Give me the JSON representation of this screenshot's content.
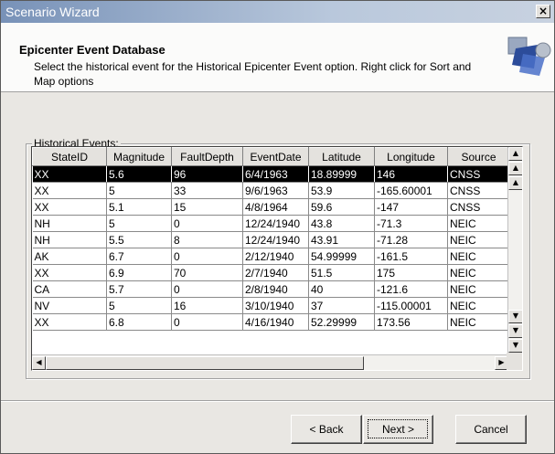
{
  "window": {
    "title": "Scenario Wizard",
    "close_label": "×"
  },
  "header": {
    "title": "Epicenter Event Database",
    "description": "Select the historical event for the Historical Epicenter Event option. Right click for Sort and Map options"
  },
  "group": {
    "label": "Historical Events:"
  },
  "table": {
    "columns": [
      "StateID",
      "Magnitude",
      "FaultDepth",
      "EventDate",
      "Latitude",
      "Longitude",
      "Source"
    ],
    "selected_row": 0,
    "rows": [
      [
        "XX",
        "5.6",
        "96",
        "6/4/1963",
        "18.89999",
        "146",
        "CNSS"
      ],
      [
        "XX",
        "5",
        "33",
        "9/6/1963",
        "53.9",
        "-165.60001",
        "CNSS"
      ],
      [
        "XX",
        "5.1",
        "15",
        "4/8/1964",
        "59.6",
        "-147",
        "CNSS"
      ],
      [
        "NH",
        "5",
        "0",
        "12/24/1940",
        "43.8",
        "-71.3",
        "NEIC"
      ],
      [
        "NH",
        "5.5",
        "8",
        "12/24/1940",
        "43.91",
        "-71.28",
        "NEIC"
      ],
      [
        "AK",
        "6.7",
        "0",
        "2/12/1940",
        "54.99999",
        "-161.5",
        "NEIC"
      ],
      [
        "XX",
        "6.9",
        "70",
        "2/7/1940",
        "51.5",
        "175",
        "NEIC"
      ],
      [
        "CA",
        "5.7",
        "0",
        "2/8/1940",
        "40",
        "-121.6",
        "NEIC"
      ],
      [
        "NV",
        "5",
        "16",
        "3/10/1940",
        "37",
        "-115.00001",
        "NEIC"
      ],
      [
        "XX",
        "6.8",
        "0",
        "4/16/1940",
        "52.29999",
        "173.56",
        "NEIC"
      ]
    ]
  },
  "buttons": {
    "back": "< Back",
    "next": "Next >",
    "cancel": "Cancel"
  },
  "icons": {
    "logo": "wizard-logo-icon",
    "scroll_top": "scroll-top-icon",
    "scroll_page_up": "scroll-page-up-icon",
    "scroll_up": "scroll-up-icon",
    "scroll_down": "scroll-down-icon",
    "scroll_page_down": "scroll-page-down-icon",
    "scroll_bottom": "scroll-bottom-icon",
    "scroll_left": "scroll-left-icon",
    "scroll_right": "scroll-right-icon"
  }
}
